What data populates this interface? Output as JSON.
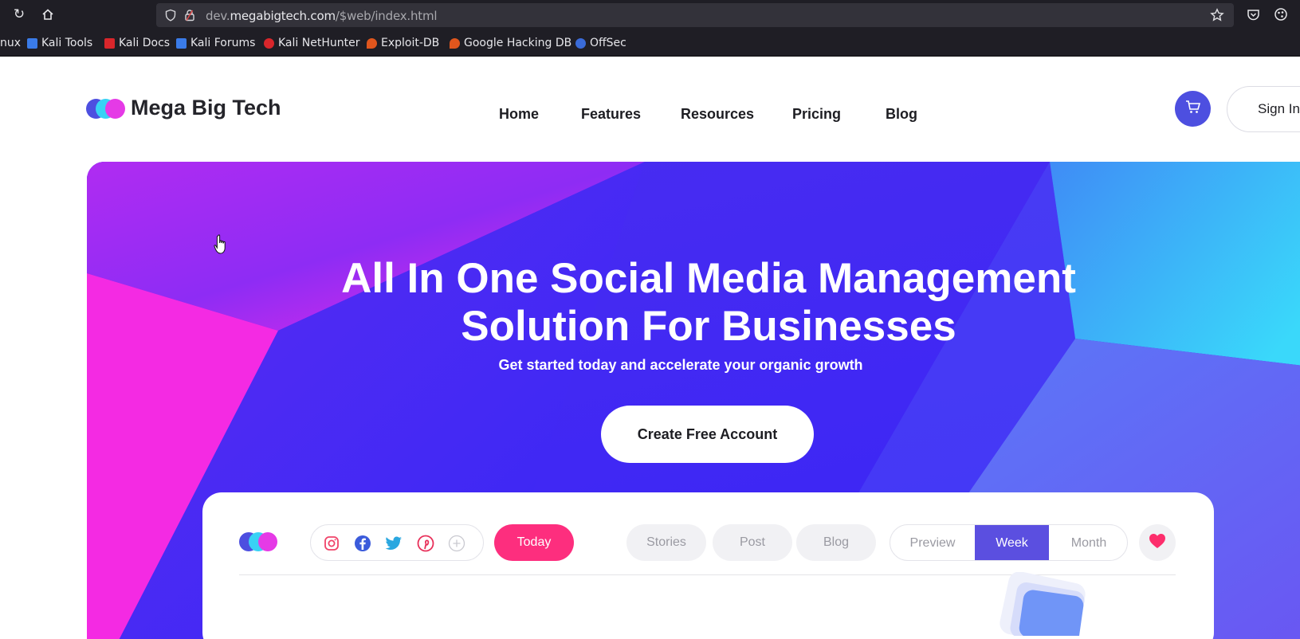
{
  "browser": {
    "url_prefix": "dev.",
    "url_domain": "megabigtech.com",
    "url_path": "/$web/index.html",
    "bookmarks": [
      {
        "label": "nux",
        "color": ""
      },
      {
        "label": "Kali Tools",
        "color": "#3a7be8"
      },
      {
        "label": "Kali Docs",
        "color": "#d9262b"
      },
      {
        "label": "Kali Forums",
        "color": "#3a7be8"
      },
      {
        "label": "Kali NetHunter",
        "color": "#d9262b"
      },
      {
        "label": "Exploit-DB",
        "color": "#e0561d"
      },
      {
        "label": "Google Hacking DB",
        "color": "#e0561d"
      },
      {
        "label": "OffSec",
        "color": "#3a6bd8"
      }
    ]
  },
  "site": {
    "brand": "Mega Big Tech",
    "nav": [
      "Home",
      "Features",
      "Resources",
      "Pricing",
      "Blog"
    ],
    "sign_in": "Sign In",
    "accent": "#4d4fe0"
  },
  "hero": {
    "title_line1": "All In One Social Media Management",
    "title_line2": "Solution For Businesses",
    "subtitle": "Get started today and accelerate your organic growth",
    "cta": "Create Free Account"
  },
  "dashboard": {
    "social_icons": [
      "instagram-icon",
      "facebook-icon",
      "twitter-icon",
      "pinterest-icon",
      "add-icon"
    ],
    "today": "Today",
    "content_tabs": [
      "Stories",
      "Post",
      "Blog"
    ],
    "view_tabs": [
      "Preview",
      "Week",
      "Month"
    ],
    "active_view": "Week",
    "today_color": "#fd2e7e"
  }
}
